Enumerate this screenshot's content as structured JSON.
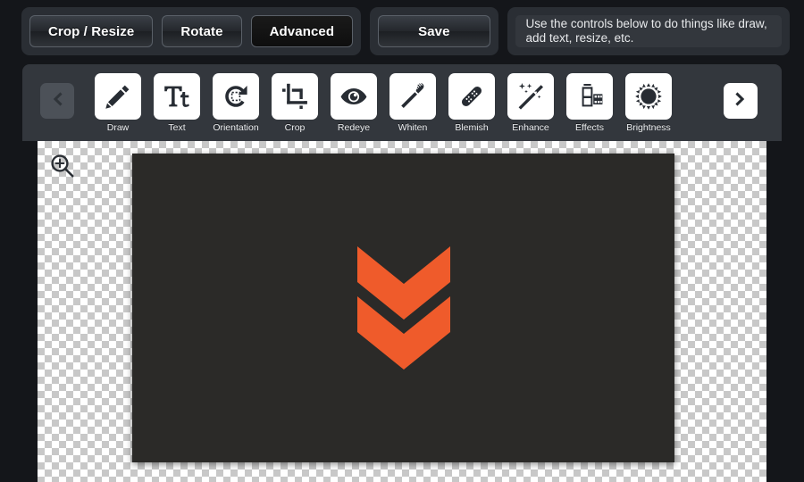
{
  "topbar": {
    "buttons": [
      {
        "label": "Crop / Resize",
        "state": "normal"
      },
      {
        "label": "Rotate",
        "state": "normal"
      },
      {
        "label": "Advanced",
        "state": "active"
      }
    ],
    "save_button": {
      "label": "Save",
      "state": "normal"
    },
    "help_text": "Use the controls below to do things like draw, add text, resize, etc."
  },
  "toolbar": {
    "prev_arrow": {
      "icon": "chevron-left-icon",
      "enabled": false
    },
    "next_arrow": {
      "icon": "chevron-right-icon",
      "enabled": true
    },
    "tools": [
      {
        "label": "Draw",
        "icon": "pencil-icon"
      },
      {
        "label": "Text",
        "icon": "text-tt-icon"
      },
      {
        "label": "Orientation",
        "icon": "rotate-icon"
      },
      {
        "label": "Crop",
        "icon": "crop-icon"
      },
      {
        "label": "Redeye",
        "icon": "eye-icon"
      },
      {
        "label": "Whiten",
        "icon": "toothbrush-icon"
      },
      {
        "label": "Blemish",
        "icon": "bandage-icon"
      },
      {
        "label": "Enhance",
        "icon": "magic-wand-icon"
      },
      {
        "label": "Effects",
        "icon": "film-strip-icon"
      },
      {
        "label": "Brightness",
        "icon": "sun-icon"
      }
    ]
  },
  "canvas": {
    "zoom_control": {
      "icon": "magnifier-plus-icon"
    },
    "image": {
      "background_color": "#2b2a28",
      "artwork": "double-chevron-down-logo",
      "accent_color": "#ef5b2b"
    },
    "transparency_checker": true
  },
  "colors": {
    "page_background": "#14161a",
    "panel": "#33373d",
    "button_group": "#2a2e34",
    "icon_tile": "#ffffff",
    "icon_glyph": "#272c33",
    "accent_orange": "#ef5b2b",
    "image_dark": "#2b2a28",
    "label_text": "#eceef0"
  }
}
